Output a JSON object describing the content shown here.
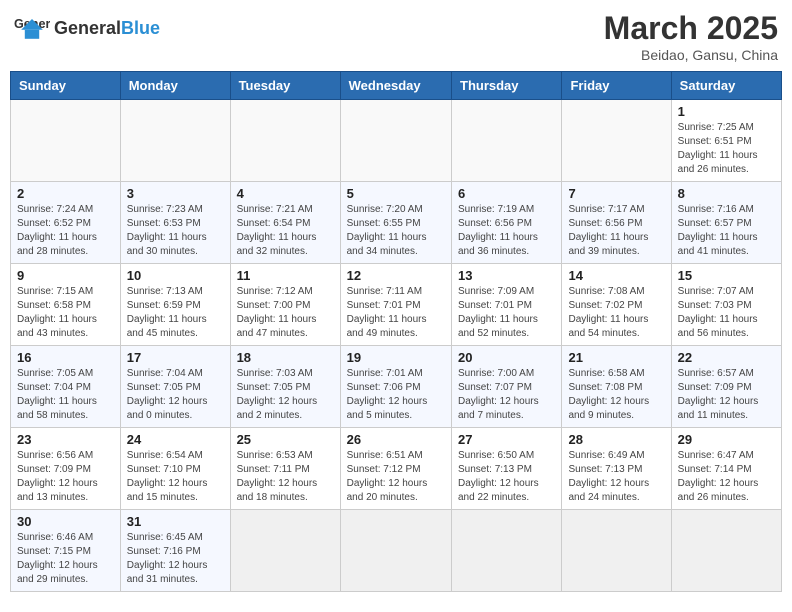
{
  "header": {
    "logo_text_normal": "General",
    "logo_text_accent": "Blue",
    "month_title": "March 2025",
    "location": "Beidao, Gansu, China"
  },
  "days_of_week": [
    "Sunday",
    "Monday",
    "Tuesday",
    "Wednesday",
    "Thursday",
    "Friday",
    "Saturday"
  ],
  "weeks": [
    [
      {
        "day": null
      },
      {
        "day": null
      },
      {
        "day": null
      },
      {
        "day": null
      },
      {
        "day": null
      },
      {
        "day": null
      },
      {
        "day": 1,
        "sunrise": "7:25 AM",
        "sunset": "6:51 PM",
        "daylight": "11 hours and 26 minutes."
      }
    ],
    [
      {
        "day": 2,
        "sunrise": "7:24 AM",
        "sunset": "6:52 PM",
        "daylight": "11 hours and 28 minutes."
      },
      {
        "day": 3,
        "sunrise": "7:23 AM",
        "sunset": "6:53 PM",
        "daylight": "11 hours and 30 minutes."
      },
      {
        "day": 4,
        "sunrise": "7:21 AM",
        "sunset": "6:54 PM",
        "daylight": "11 hours and 32 minutes."
      },
      {
        "day": 5,
        "sunrise": "7:20 AM",
        "sunset": "6:55 PM",
        "daylight": "11 hours and 34 minutes."
      },
      {
        "day": 6,
        "sunrise": "7:19 AM",
        "sunset": "6:56 PM",
        "daylight": "11 hours and 36 minutes."
      },
      {
        "day": 7,
        "sunrise": "7:17 AM",
        "sunset": "6:56 PM",
        "daylight": "11 hours and 39 minutes."
      },
      {
        "day": 8,
        "sunrise": "7:16 AM",
        "sunset": "6:57 PM",
        "daylight": "11 hours and 41 minutes."
      }
    ],
    [
      {
        "day": 9,
        "sunrise": "7:15 AM",
        "sunset": "6:58 PM",
        "daylight": "11 hours and 43 minutes."
      },
      {
        "day": 10,
        "sunrise": "7:13 AM",
        "sunset": "6:59 PM",
        "daylight": "11 hours and 45 minutes."
      },
      {
        "day": 11,
        "sunrise": "7:12 AM",
        "sunset": "7:00 PM",
        "daylight": "11 hours and 47 minutes."
      },
      {
        "day": 12,
        "sunrise": "7:11 AM",
        "sunset": "7:01 PM",
        "daylight": "11 hours and 49 minutes."
      },
      {
        "day": 13,
        "sunrise": "7:09 AM",
        "sunset": "7:01 PM",
        "daylight": "11 hours and 52 minutes."
      },
      {
        "day": 14,
        "sunrise": "7:08 AM",
        "sunset": "7:02 PM",
        "daylight": "11 hours and 54 minutes."
      },
      {
        "day": 15,
        "sunrise": "7:07 AM",
        "sunset": "7:03 PM",
        "daylight": "11 hours and 56 minutes."
      }
    ],
    [
      {
        "day": 16,
        "sunrise": "7:05 AM",
        "sunset": "7:04 PM",
        "daylight": "11 hours and 58 minutes."
      },
      {
        "day": 17,
        "sunrise": "7:04 AM",
        "sunset": "7:05 PM",
        "daylight": "12 hours and 0 minutes."
      },
      {
        "day": 18,
        "sunrise": "7:03 AM",
        "sunset": "7:05 PM",
        "daylight": "12 hours and 2 minutes."
      },
      {
        "day": 19,
        "sunrise": "7:01 AM",
        "sunset": "7:06 PM",
        "daylight": "12 hours and 5 minutes."
      },
      {
        "day": 20,
        "sunrise": "7:00 AM",
        "sunset": "7:07 PM",
        "daylight": "12 hours and 7 minutes."
      },
      {
        "day": 21,
        "sunrise": "6:58 AM",
        "sunset": "7:08 PM",
        "daylight": "12 hours and 9 minutes."
      },
      {
        "day": 22,
        "sunrise": "6:57 AM",
        "sunset": "7:09 PM",
        "daylight": "12 hours and 11 minutes."
      }
    ],
    [
      {
        "day": 23,
        "sunrise": "6:56 AM",
        "sunset": "7:09 PM",
        "daylight": "12 hours and 13 minutes."
      },
      {
        "day": 24,
        "sunrise": "6:54 AM",
        "sunset": "7:10 PM",
        "daylight": "12 hours and 15 minutes."
      },
      {
        "day": 25,
        "sunrise": "6:53 AM",
        "sunset": "7:11 PM",
        "daylight": "12 hours and 18 minutes."
      },
      {
        "day": 26,
        "sunrise": "6:51 AM",
        "sunset": "7:12 PM",
        "daylight": "12 hours and 20 minutes."
      },
      {
        "day": 27,
        "sunrise": "6:50 AM",
        "sunset": "7:13 PM",
        "daylight": "12 hours and 22 minutes."
      },
      {
        "day": 28,
        "sunrise": "6:49 AM",
        "sunset": "7:13 PM",
        "daylight": "12 hours and 24 minutes."
      },
      {
        "day": 29,
        "sunrise": "6:47 AM",
        "sunset": "7:14 PM",
        "daylight": "12 hours and 26 minutes."
      }
    ],
    [
      {
        "day": 30,
        "sunrise": "6:46 AM",
        "sunset": "7:15 PM",
        "daylight": "12 hours and 29 minutes."
      },
      {
        "day": 31,
        "sunrise": "6:45 AM",
        "sunset": "7:16 PM",
        "daylight": "12 hours and 31 minutes."
      },
      {
        "day": null
      },
      {
        "day": null
      },
      {
        "day": null
      },
      {
        "day": null
      },
      {
        "day": null
      }
    ]
  ]
}
